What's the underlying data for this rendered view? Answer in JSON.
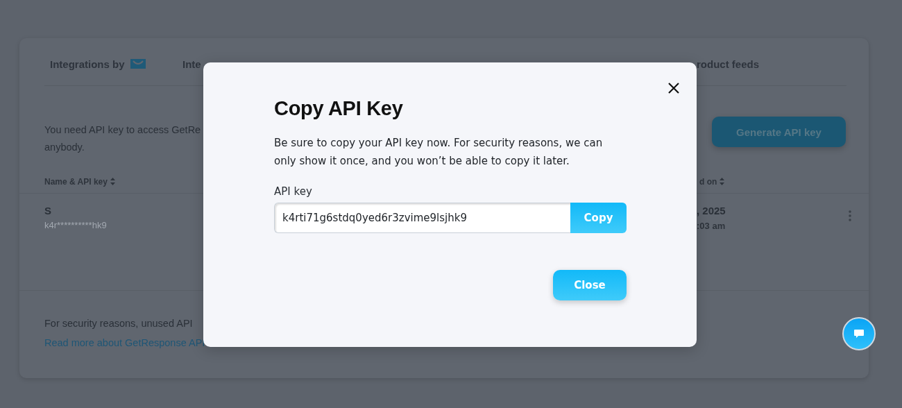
{
  "background_page": {
    "tabs": [
      {
        "label": "Integrations by"
      },
      {
        "label": "Inte"
      },
      {
        "label": "roduct feeds"
      }
    ],
    "intro": [
      "You need API key to access GetRe",
      "anybody."
    ],
    "generate_button": "Generate API key",
    "table": {
      "columns": [
        "Name & API key",
        "d on"
      ],
      "rows": [
        {
          "name": "S",
          "masked_key": "k4r**********hk9",
          "date": ", 2025",
          "time": ":03 am"
        }
      ]
    },
    "footer": {
      "text": "For security reasons, unused API",
      "link": "Read more about GetResponse API"
    }
  },
  "modal": {
    "title": "Copy API Key",
    "text": "Be sure to copy your API key now. For security reasons, we can only show it once, and you won’t be able to copy it later.",
    "field_label": "API key",
    "value": "k4rti71g6stdq0yed6r3zvime9lsjhk9",
    "copy_button": "Copy",
    "close_button": "Close"
  }
}
